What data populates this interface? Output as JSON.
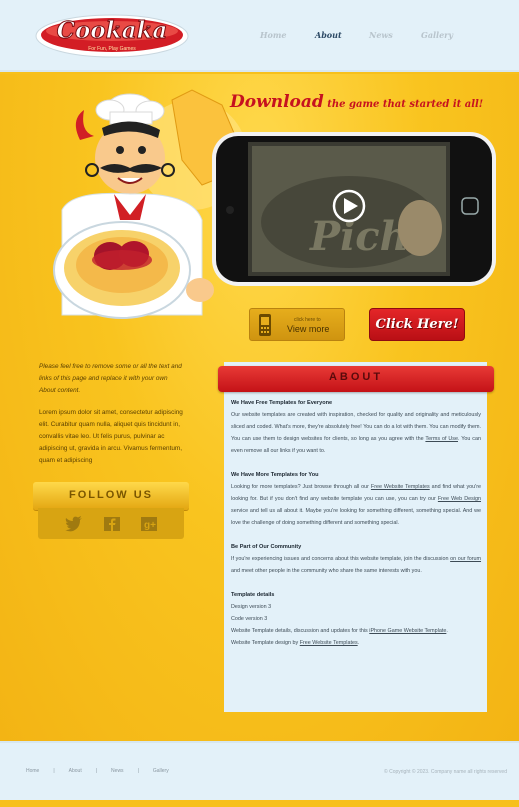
{
  "logo": {
    "name": "Cookaka",
    "tagline": "For Fun, Play Games"
  },
  "nav": [
    {
      "label": "Home",
      "active": false
    },
    {
      "label": "About",
      "active": true
    },
    {
      "label": "News",
      "active": false
    },
    {
      "label": "Gallery",
      "active": false
    }
  ],
  "hero": {
    "download_word": "Download",
    "download_rest": " the game that started it all!",
    "view_more_small": "click here to",
    "view_more_label": "View more",
    "click_here_label": "Click Here!",
    "play_icon": "play-icon",
    "phone_icon": "mobile-phone-icon"
  },
  "sidebar": {
    "intro_italic": "Please feel free to remove some or all the text and links of this page and replace it with your own About content.",
    "intro_text": "Lorem ipsum dolor sit amet, consectetur adipiscing elit. Curabitur quam nulla, aliquet quis tincidunt in, convallis vitae leo. Ut felis purus, pulvinar ac adipiscing ut, gravida in arcu. Vivamus fermentum, quam et adipiscing",
    "follow_title": "FOLLOW US",
    "social_icons": [
      "twitter-icon",
      "facebook-icon",
      "google-plus-icon"
    ]
  },
  "about": {
    "title": "ABOUT",
    "s1_title": "We Have Free Templates for Everyone",
    "s1_a": "Our website templates are created with inspiration, checked for quality and originality and meticulously sliced and coded. What's more, they're absolutely free! You can do a lot with them. You can modify them. You can use them to design websites for clients, so long as you agree with the ",
    "s1_link": "Terms of Use",
    "s1_b": ". You can even remove all our links if you want to.",
    "s2_title": "We Have More Templates for You",
    "s2_a": "Looking for more templates? Just browse through all our ",
    "s2_link1": "Free Website Templates",
    "s2_b": " and find what you're looking for. But if you don't find any website template you can use, you can try our ",
    "s2_link2": "Free Web Design",
    "s2_c": " service and tell us all about it. Maybe you're looking for something different, something special. And we love the challenge of doing something different and something special.",
    "s3_title": "Be Part of Our Community",
    "s3_a": "If you're experiencing issues and concerns about this website template, join the discussion ",
    "s3_link": "on our forum",
    "s3_b": " and meet other people in the community who share the same interests with you.",
    "s4_title": "Template details",
    "design_version": "Design version 3",
    "code_version": "Code version 3",
    "details_a": "Website Template details, discussion and updates for this ",
    "details_link": "iPhone Game Website Template",
    "details_b": ".",
    "design_by_a": "Website Template design by ",
    "design_by_link": "Free Website Templates",
    "design_by_b": "."
  },
  "footer": {
    "links": [
      "Home",
      "About",
      "News",
      "Gallery"
    ],
    "separator": "|",
    "copyright": "© Copyright © 2023. Company name all rights reserved"
  },
  "colors": {
    "header_bg": "#e3f1f9",
    "main_yellow": "#f7c01c",
    "brand_red": "#c6121f",
    "nav_active": "#2d4a66"
  }
}
